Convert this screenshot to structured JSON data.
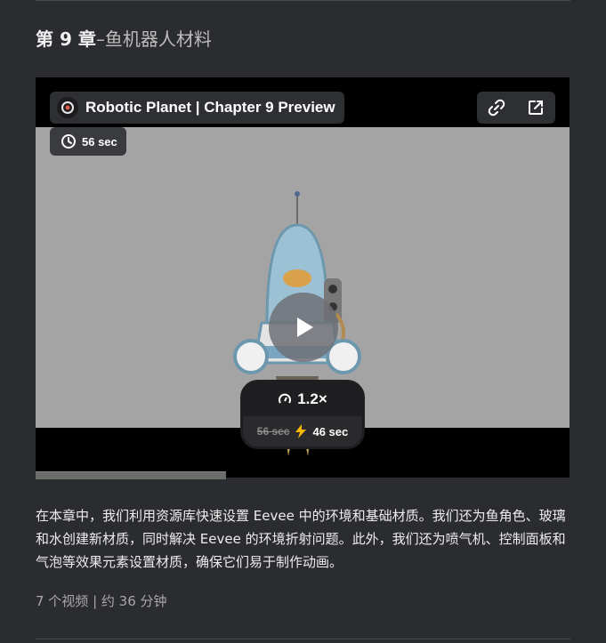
{
  "chapter": {
    "number": "第 9 章",
    "separator": "–",
    "name": "鱼机器人材料"
  },
  "video": {
    "title": "Robotic Planet | Chapter 9 Preview",
    "duration": "56 sec",
    "speed": {
      "multiplier": "1.2×",
      "original_time": "56 sec",
      "new_time": "46 sec"
    },
    "icons": {
      "logo": "channel-logo-icon",
      "link": "link-icon",
      "external": "external-link-icon",
      "clock": "clock-icon",
      "play": "play-icon",
      "speedometer": "speedometer-icon",
      "lightning": "lightning-icon"
    }
  },
  "description": "在本章中，我们利用资源库快速设置 Eevee 中的环境和基础材质。我们还为鱼角色、玻璃和水创建新材质，同时解决 Eevee 的环境折射问题。此外，我们还为喷气机、控制面板和气泡等效果元素设置材质，确保它们易于制作动画。",
  "meta": "7 个视频 | 约 36 分钟",
  "colors": {
    "background": "#2b2c30",
    "video_frame": "#a4a4a4",
    "pill": "#2e2f33",
    "lightning": "#f5b800"
  }
}
